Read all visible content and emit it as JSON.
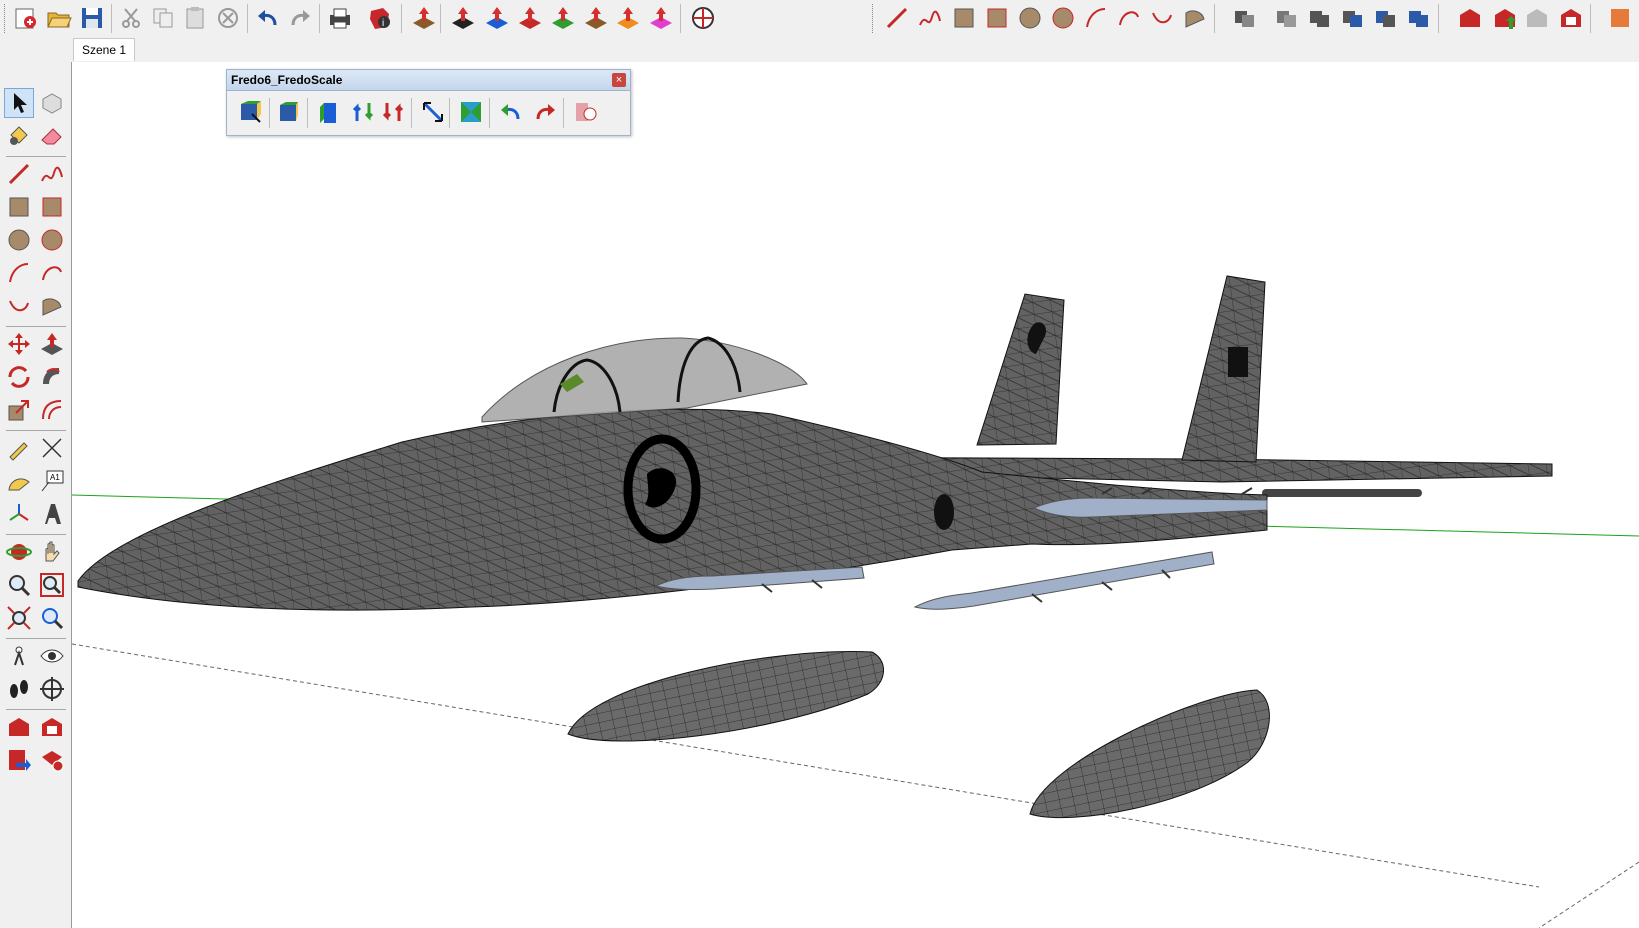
{
  "scenes": {
    "tabs": [
      {
        "label": "Szene 1"
      }
    ]
  },
  "floating_toolbar": {
    "title": "Fredo6_FredoScale",
    "close_glyph": "×"
  },
  "viewport": {
    "axis_colors": {
      "green": "#1aa31a",
      "red": "#c0392b"
    },
    "model_color": "#5a5a5a"
  },
  "top_toolbar": {
    "icons": [
      "new-icon",
      "open-icon",
      "save-icon",
      "cut-icon",
      "copy-icon",
      "paste-icon",
      "erase-icon",
      "undo-icon",
      "redo-icon",
      "print-icon",
      "model-info-icon",
      "push-pull-icon",
      "extrude-1-icon",
      "extrude-2-icon",
      "extrude-3-icon",
      "extrude-4-icon",
      "extrude-5-icon",
      "extrude-6-icon",
      "extrude-7-icon",
      "geo-location-icon"
    ]
  },
  "left_toolbar": {
    "icons": [
      "select-icon",
      "component-icon",
      "paint-bucket-icon",
      "eraser-icon",
      "line-icon",
      "freehand-icon",
      "rectangle-icon",
      "rotated-rectangle-icon",
      "circle-icon",
      "polygon-icon",
      "arc-icon",
      "arc-2-icon",
      "pie-icon",
      "three-point-arc-icon",
      "move-icon",
      "push-pull-icon",
      "rotate-icon",
      "follow-me-icon",
      "scale-icon",
      "offset-icon",
      "tape-measure-icon",
      "dimension-icon",
      "protractor-icon",
      "text-icon",
      "axes-icon",
      "3d-text-icon",
      "orbit-icon",
      "pan-icon",
      "zoom-icon",
      "zoom-window-icon",
      "zoom-extents-icon",
      "previous-view-icon",
      "position-camera-icon",
      "look-around-icon",
      "walk-icon",
      "section-plane-icon",
      "warehouse-icon",
      "extension-warehouse-icon",
      "send-to-layout-icon",
      "extension-manager-icon"
    ]
  }
}
